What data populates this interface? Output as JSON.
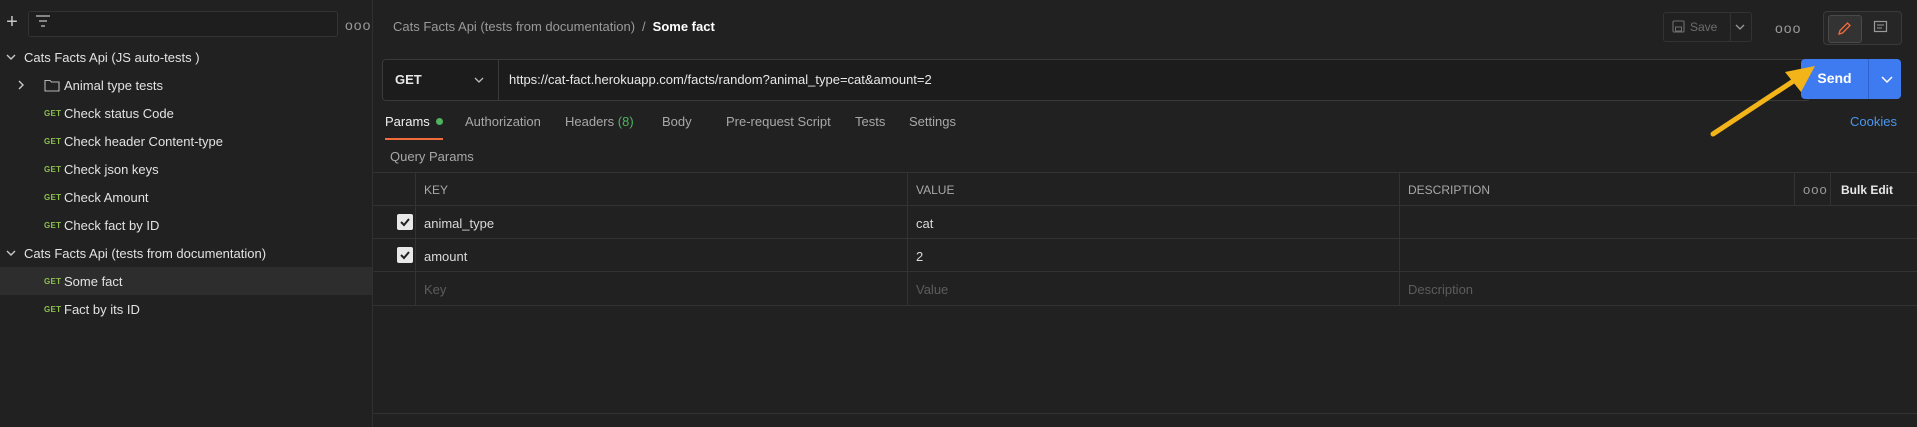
{
  "sidebar": {
    "add_icon": "plus-icon",
    "filter_icon": "filter-icon",
    "more_icon": "more-horizontal-icon",
    "more_label": "ooo",
    "collections": [
      {
        "name": "Cats Facts Api (JS auto-tests )",
        "folder": "Animal type tests",
        "requests": [
          {
            "method": "GET",
            "name": "Check status Code"
          },
          {
            "method": "GET",
            "name": "Check header Content-type"
          },
          {
            "method": "GET",
            "name": "Check json keys"
          },
          {
            "method": "GET",
            "name": "Check Amount"
          },
          {
            "method": "GET",
            "name": "Check fact by ID"
          }
        ]
      },
      {
        "name": "Cats Facts Api (tests from documentation)",
        "requests": [
          {
            "method": "GET",
            "name": "Some fact",
            "selected": true
          },
          {
            "method": "GET",
            "name": "Fact by its ID"
          }
        ]
      }
    ]
  },
  "header": {
    "breadcrumb_parent": "Cats Facts Api (tests from documentation)",
    "breadcrumb_sep": "/",
    "breadcrumb_current": "Some fact",
    "save_label": "Save",
    "more_label": "ooo"
  },
  "request": {
    "method": "GET",
    "url": "https://cat-fact.herokuapp.com/facts/random?animal_type=cat&amount=2",
    "send_label": "Send"
  },
  "tabs": {
    "params": "Params",
    "authorization": "Authorization",
    "headers": "Headers",
    "headers_count": "(8)",
    "body": "Body",
    "prerequest": "Pre-request Script",
    "tests": "Tests",
    "settings": "Settings",
    "cookies": "Cookies"
  },
  "query_params": {
    "title": "Query Params",
    "columns": {
      "key": "KEY",
      "value": "VALUE",
      "description": "DESCRIPTION"
    },
    "more_label": "ooo",
    "bulk_edit": "Bulk Edit",
    "rows": [
      {
        "checked": true,
        "key": "animal_type",
        "value": "cat",
        "description": ""
      },
      {
        "checked": true,
        "key": "amount",
        "value": "2",
        "description": ""
      }
    ],
    "placeholders": {
      "key": "Key",
      "value": "Value",
      "description": "Description"
    }
  },
  "colors": {
    "background": "#212121",
    "accent": "#3e7bf0",
    "get_method": "#8cbf4d",
    "tab_underline": "#f26b3a",
    "status_dot": "#4fb360",
    "annotation_arrow": "#f2b418"
  }
}
